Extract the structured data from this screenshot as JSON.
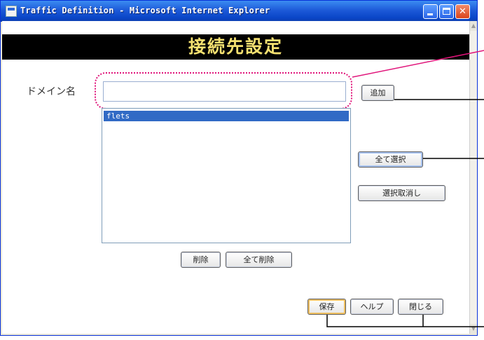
{
  "window": {
    "title": "Traffic Definition - Microsoft Internet Explorer",
    "minimize_icon": "minimize-icon",
    "maximize_icon": "maximize-icon",
    "close_label": "✕"
  },
  "page": {
    "heading": "接続先設定"
  },
  "form": {
    "domain_label": "ドメイン名",
    "domain_value": "",
    "add_button": "追加"
  },
  "list": {
    "items": [
      "flets"
    ],
    "selected_index": 0
  },
  "buttons": {
    "select_all": "全て選択",
    "deselect": "選択取消し",
    "delete": "削除",
    "delete_all": "全て削除",
    "save": "保存",
    "help": "ヘルプ",
    "close": "閉じる"
  },
  "colors": {
    "title_bar": "#0a46c8",
    "heading_bg": "#000000",
    "heading_text": "#f4e070",
    "callout": "#e0147a",
    "selection": "#316ac5"
  }
}
